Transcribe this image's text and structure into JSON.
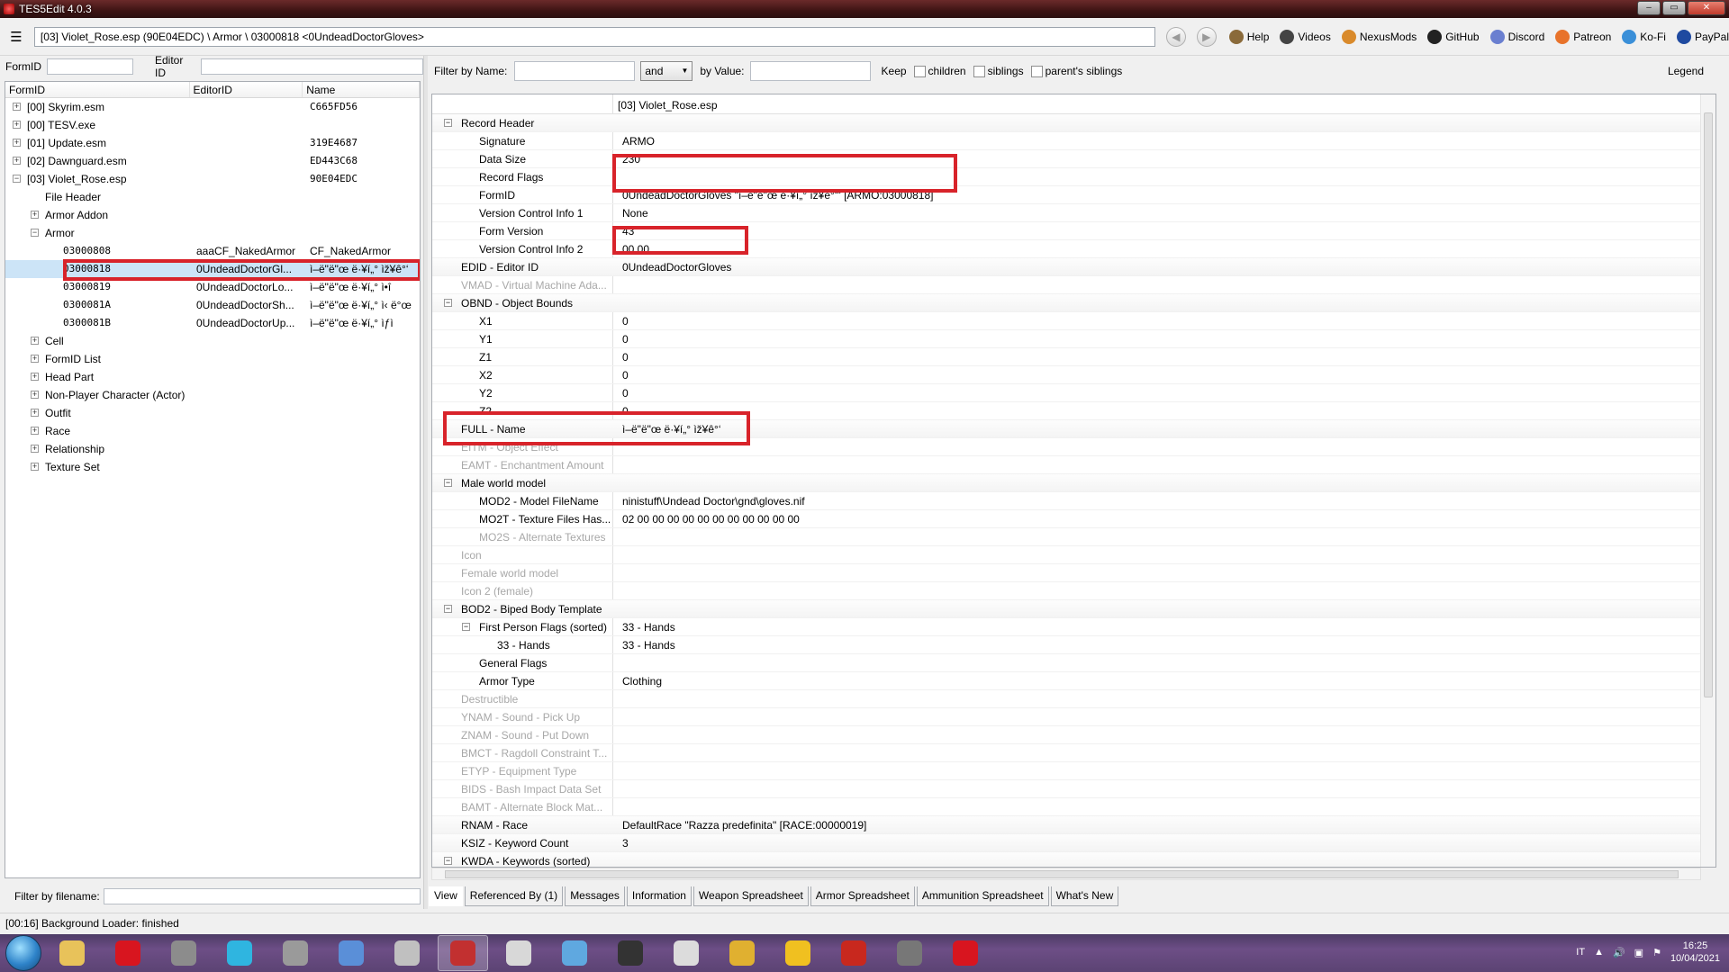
{
  "window": {
    "title": "TES5Edit 4.0.3"
  },
  "toolbar": {
    "path": "[03] Violet_Rose.esp (90E04EDC) \\ Armor \\ 03000818 <0UndeadDoctorGloves>",
    "links": [
      {
        "label": "Help",
        "icon": "book-icon",
        "color": "#8a6a3a"
      },
      {
        "label": "Videos",
        "icon": "video-icon",
        "color": "#444444"
      },
      {
        "label": "NexusMods",
        "icon": "nexus-icon",
        "color": "#d98a2b"
      },
      {
        "label": "GitHub",
        "icon": "github-icon",
        "color": "#222222"
      },
      {
        "label": "Discord",
        "icon": "discord-icon",
        "color": "#6a7fd0"
      },
      {
        "label": "Patreon",
        "icon": "patreon-icon",
        "color": "#e8732b"
      },
      {
        "label": "Ko-Fi",
        "icon": "kofi-icon",
        "color": "#3a8fd8"
      },
      {
        "label": "PayPal",
        "icon": "paypal-icon",
        "color": "#1f4aa0"
      }
    ]
  },
  "left": {
    "formid_label": "FormID",
    "editorid_label": "Editor ID",
    "columns": [
      "FormID",
      "EditorID",
      "Name"
    ],
    "rows": [
      {
        "indent": 0,
        "exp": "+",
        "c1": "[00] Skyrim.esm",
        "c2": "",
        "c3": "C665FD56",
        "mono3": true
      },
      {
        "indent": 0,
        "exp": "+",
        "c1": "[00] TESV.exe",
        "c2": "",
        "c3": ""
      },
      {
        "indent": 0,
        "exp": "+",
        "c1": "[01] Update.esm",
        "c2": "",
        "c3": "319E4687",
        "mono3": true
      },
      {
        "indent": 0,
        "exp": "+",
        "c1": "[02] Dawnguard.esm",
        "c2": "",
        "c3": "ED443C68",
        "mono3": true
      },
      {
        "indent": 0,
        "exp": "−",
        "c1": "[03] Violet_Rose.esp",
        "c2": "",
        "c3": "90E04EDC",
        "mono3": true
      },
      {
        "indent": 1,
        "exp": "",
        "c1": "File Header",
        "c2": "",
        "c3": ""
      },
      {
        "indent": 1,
        "exp": "+",
        "c1": "Armor Addon",
        "c2": "",
        "c3": ""
      },
      {
        "indent": 1,
        "exp": "−",
        "c1": "Armor",
        "c2": "",
        "c3": ""
      },
      {
        "indent": 2,
        "exp": "",
        "c1": "03000808",
        "c2": "aaaCF_NakedArmor",
        "c3": "CF_NakedArmor",
        "mono1": true
      },
      {
        "indent": 2,
        "exp": "",
        "c1": "03000818",
        "c2": "0UndeadDoctorGl...",
        "c3": "ì–ë\"ë\"œ ë·¥í„° ìž¥ê°‘",
        "mono1": true,
        "selected": true
      },
      {
        "indent": 2,
        "exp": "",
        "c1": "03000819",
        "c2": "0UndeadDoctorLo...",
        "c3": "ì–ë\"ë\"œ ë·¥í„° ì•î",
        "mono1": true
      },
      {
        "indent": 2,
        "exp": "",
        "c1": "0300081A",
        "c2": "0UndeadDoctorSh...",
        "c3": "ì–ë\"ë\"œ ë·¥í„° ì‹ ë°œ",
        "mono1": true
      },
      {
        "indent": 2,
        "exp": "",
        "c1": "0300081B",
        "c2": "0UndeadDoctorUp...",
        "c3": "ì–ë\"ë\"œ ë·¥í„° ìƒì",
        "mono1": true
      },
      {
        "indent": 1,
        "exp": "+",
        "c1": "Cell",
        "c2": "",
        "c3": ""
      },
      {
        "indent": 1,
        "exp": "+",
        "c1": "FormID List",
        "c2": "",
        "c3": ""
      },
      {
        "indent": 1,
        "exp": "+",
        "c1": "Head Part",
        "c2": "",
        "c3": ""
      },
      {
        "indent": 1,
        "exp": "+",
        "c1": "Non-Player Character (Actor)",
        "c2": "",
        "c3": ""
      },
      {
        "indent": 1,
        "exp": "+",
        "c1": "Outfit",
        "c2": "",
        "c3": ""
      },
      {
        "indent": 1,
        "exp": "+",
        "c1": "Race",
        "c2": "",
        "c3": ""
      },
      {
        "indent": 1,
        "exp": "+",
        "c1": "Relationship",
        "c2": "",
        "c3": ""
      },
      {
        "indent": 1,
        "exp": "+",
        "c1": "Texture Set",
        "c2": "",
        "c3": ""
      }
    ],
    "filename_filter_label": "Filter by filename:"
  },
  "filter": {
    "by_name_label": "Filter by Name:",
    "operator": "and",
    "by_value_label": "by Value:",
    "keep_label": "Keep",
    "children_label": "children",
    "siblings_label": "siblings",
    "parents_siblings_label": "parent's siblings",
    "legend_label": "Legend"
  },
  "record": {
    "file_header": "[03] Violet_Rose.esp",
    "rows": [
      {
        "level": 0,
        "exp": "−",
        "label": "Record Header",
        "value": "",
        "section": true
      },
      {
        "level": 1,
        "label": "Signature",
        "value": "ARMO"
      },
      {
        "level": 1,
        "label": "Data Size",
        "value": "230"
      },
      {
        "level": 1,
        "label": "Record Flags",
        "value": ""
      },
      {
        "level": 1,
        "label": "FormID",
        "value": "0UndeadDoctorGloves \"ì–ë\"ë\"œ ë·¥í„° ìž¥ê°‘\" [ARMO:03000818]"
      },
      {
        "level": 1,
        "label": "Version Control Info 1",
        "value": "None"
      },
      {
        "level": 1,
        "label": "Form Version",
        "value": "43"
      },
      {
        "level": 1,
        "label": "Version Control Info 2",
        "value": "00 00"
      },
      {
        "level": 0,
        "label": "EDID - Editor ID",
        "value": "0UndeadDoctorGloves",
        "section": true
      },
      {
        "level": 0,
        "label": "VMAD - Virtual Machine Ada...",
        "value": "",
        "disabled": true
      },
      {
        "level": 0,
        "exp": "−",
        "label": "OBND - Object Bounds",
        "value": "",
        "section": true
      },
      {
        "level": 1,
        "label": "X1",
        "value": "0"
      },
      {
        "level": 1,
        "label": "Y1",
        "value": "0"
      },
      {
        "level": 1,
        "label": "Z1",
        "value": "0"
      },
      {
        "level": 1,
        "label": "X2",
        "value": "0"
      },
      {
        "level": 1,
        "label": "Y2",
        "value": "0"
      },
      {
        "level": 1,
        "label": "Z2",
        "value": "0"
      },
      {
        "level": 0,
        "label": "FULL - Name",
        "value": "ì–ë\"ë\"œ ë·¥í„° ìž¥ê°‘",
        "section": true
      },
      {
        "level": 0,
        "label": "EITM - Object Effect",
        "value": "",
        "disabled": true
      },
      {
        "level": 0,
        "label": "EAMT - Enchantment Amount",
        "value": "",
        "disabled": true
      },
      {
        "level": 0,
        "exp": "−",
        "label": "Male world model",
        "value": "",
        "section": true
      },
      {
        "level": 1,
        "label": "MOD2 - Model FileName",
        "value": "ninistuff\\Undead Doctor\\gnd\\gloves.nif"
      },
      {
        "level": 1,
        "label": "MO2T - Texture Files Has...",
        "value": "02 00 00 00 00 00 00 00 00 00 00 00"
      },
      {
        "level": 1,
        "label": "MO2S - Alternate Textures",
        "value": "",
        "disabled": true
      },
      {
        "level": 0,
        "label": "Icon",
        "value": "",
        "disabled": true
      },
      {
        "level": 0,
        "label": "Female world model",
        "value": "",
        "disabled": true
      },
      {
        "level": 0,
        "label": "Icon 2 (female)",
        "value": "",
        "disabled": true
      },
      {
        "level": 0,
        "exp": "−",
        "label": "BOD2 - Biped Body Template",
        "value": "",
        "section": true
      },
      {
        "level": 1,
        "exp": "−",
        "label": "First Person Flags (sorted)",
        "value": "33 - Hands"
      },
      {
        "level": 2,
        "label": "33 - Hands",
        "value": "33 - Hands"
      },
      {
        "level": 1,
        "label": "General Flags",
        "value": ""
      },
      {
        "level": 1,
        "label": "Armor Type",
        "value": "Clothing"
      },
      {
        "level": 0,
        "label": "Destructible",
        "value": "",
        "disabled": true
      },
      {
        "level": 0,
        "label": "YNAM - Sound - Pick Up",
        "value": "",
        "disabled": true
      },
      {
        "level": 0,
        "label": "ZNAM - Sound - Put Down",
        "value": "",
        "disabled": true
      },
      {
        "level": 0,
        "label": "BMCT - Ragdoll Constraint T...",
        "value": "",
        "disabled": true
      },
      {
        "level": 0,
        "label": "ETYP - Equipment Type",
        "value": "",
        "disabled": true
      },
      {
        "level": 0,
        "label": "BIDS - Bash Impact Data Set",
        "value": "",
        "disabled": true
      },
      {
        "level": 0,
        "label": "BAMT - Alternate Block Mat...",
        "value": "",
        "disabled": true
      },
      {
        "level": 0,
        "label": "RNAM - Race",
        "value": "DefaultRace \"Razza predefinita\" [RACE:00000019]",
        "section": true
      },
      {
        "level": 0,
        "label": "KSIZ - Keyword Count",
        "value": "3",
        "section": true
      },
      {
        "level": 0,
        "exp": "−",
        "label": "KWDA - Keywords (sorted)",
        "value": "",
        "section": true
      }
    ]
  },
  "tabs": [
    "View",
    "Referenced By (1)",
    "Messages",
    "Information",
    "Weapon Spreadsheet",
    "Armor Spreadsheet",
    "Ammunition Spreadsheet",
    "What's New"
  ],
  "status": "[00:16] Background Loader: finished",
  "taskbar": {
    "items": [
      {
        "name": "explorer-icon",
        "color": "#e8c25a"
      },
      {
        "name": "opera-icon",
        "color": "#d8151f"
      },
      {
        "name": "media-icon",
        "color": "#8c8c8c"
      },
      {
        "name": "music-icon",
        "color": "#2fb5e0"
      },
      {
        "name": "speaker-icon",
        "color": "#9a9a9a"
      },
      {
        "name": "ffdec-icon",
        "color": "#5a8fd8"
      },
      {
        "name": "feather-icon",
        "color": "#c0c0c0"
      },
      {
        "name": "tes5edit-icon",
        "color": "#c23030",
        "active": true
      },
      {
        "name": "people-icon",
        "color": "#d8d8d8"
      },
      {
        "name": "headphones-icon",
        "color": "#5fa8e0"
      },
      {
        "name": "wmm-icon",
        "color": "#333333"
      },
      {
        "name": "window-icon",
        "color": "#dcdcdc"
      },
      {
        "name": "arrow-icon",
        "color": "#e0b030"
      },
      {
        "name": "notes-icon",
        "color": "#f0c020"
      },
      {
        "name": "filezilla-icon",
        "color": "#c8281e"
      },
      {
        "name": "creation-icon",
        "color": "#777777"
      },
      {
        "name": "opera-icon",
        "color": "#d8151f"
      }
    ],
    "lang": "IT",
    "time": "16:25",
    "date": "10/04/2021"
  }
}
